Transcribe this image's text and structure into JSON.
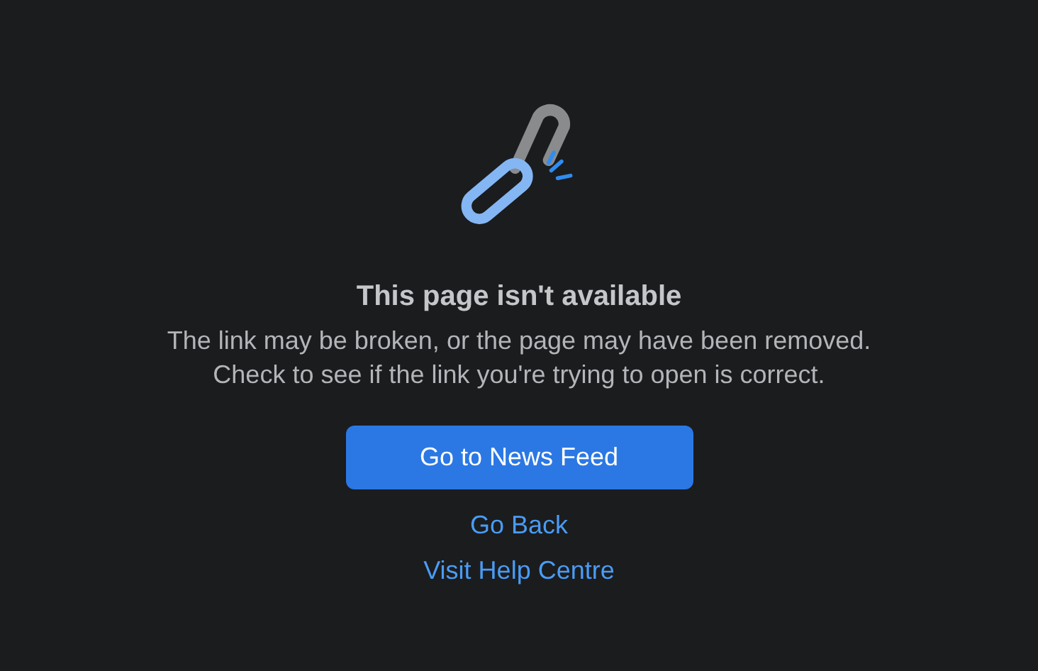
{
  "title": "This page isn't available",
  "message": "The link may be broken, or the page may have been removed. Check to see if the link you're trying to open is correct.",
  "primary_button": "Go to News Feed",
  "links": [
    "Go Back",
    "Visit Help Centre"
  ]
}
